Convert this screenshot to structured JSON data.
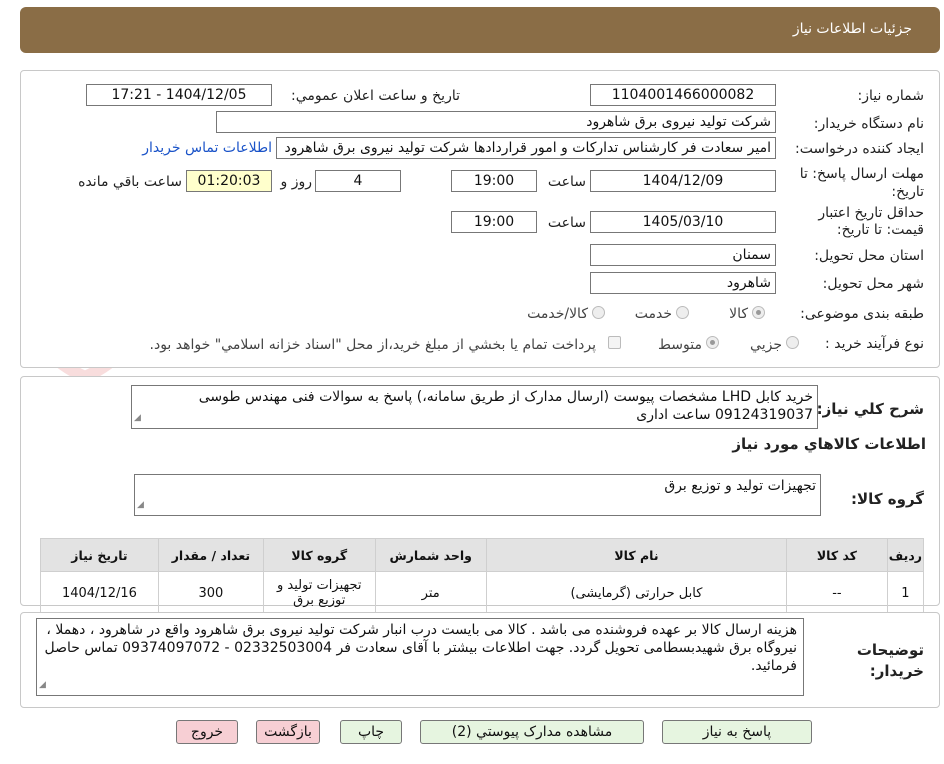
{
  "header": {
    "title": "جزئیات اطلاعات نیاز"
  },
  "need": {
    "number_label": "شماره نیاز:",
    "number": "1104001466000082",
    "announce_label": "تاریخ و ساعت اعلان عمومي:",
    "announce_value": "1404/12/05 - 17:21",
    "buyer_label": "نام دستگاه خريدار:",
    "buyer": "شرکت تولید نیروی برق شاهرود",
    "creator_label": "ايجاد کننده درخواست:",
    "creator": "امیر سعادت فر کارشناس تدارکات و امور قراردادها شرکت تولید نیروی برق شاهرود",
    "contact_link": "اطلاعات تماس خريدار",
    "reply_label_1": "مهلت ارسال پاسخ: تا",
    "reply_label_2": "تاريخ:",
    "reply_date": "1404/12/09",
    "time_label": "ساعت",
    "reply_time": "19:00",
    "days": "4",
    "days_label": "روز و",
    "remaining": "01:20:03",
    "remaining_label": "ساعت باقي مانده",
    "validity_label_1": "حداقل تاريخ اعتبار",
    "validity_label_2": "قيمت: تا تاريخ:",
    "validity_date": "1405/03/10",
    "validity_time": "19:00",
    "province_label": "استان محل تحويل:",
    "province": "سمنان",
    "city_label": "شهر محل تحويل:",
    "city": "شاهرود",
    "category_label": "طبقه بندی موضوعی:",
    "category_options": [
      "کالا",
      "خدمت",
      "کالا/خدمت"
    ],
    "category_selected": "کالا",
    "process_label": "نوع فرآيند خريد :",
    "process_options": [
      "جزيي",
      "متوسط"
    ],
    "process_selected": "متوسط",
    "payment_note": "پرداخت تمام يا بخشي از مبلغ خريد،از محل \"اسناد خزانه اسلامي\" خواهد بود."
  },
  "summary": {
    "label": "شرح کلي نياز:",
    "text": "خرید کابل LHD مشخصات پیوست (ارسال مدارک از طریق سامانه،) پاسخ به سوالات فنی مهندس طوسی 09124319037 ساعت اداری"
  },
  "goods": {
    "section_title": "اطلاعات کالاهاي مورد نياز",
    "group_label": "گروه کالا:",
    "group_value": "تجهيزات توليد و توزيع برق",
    "columns": [
      "رديف",
      "کد کالا",
      "نام کالا",
      "واحد شمارش",
      "گروه کالا",
      "تعداد / مقدار",
      "تاريخ نياز"
    ],
    "rows": [
      {
        "row": "1",
        "code": "--",
        "name": "کابل حرارتی (گرمایشی)",
        "unit": "متر",
        "group": "تجهيزات توليد و توزيع برق",
        "qty": "300",
        "date": "1404/12/16"
      }
    ]
  },
  "buyer_notes": {
    "label": "توضيحات خريدار:",
    "text": "هزینه ارسال کالا بر عهده فروشنده می باشد . کالا می بایست درب انبار شرکت تولید نیروی برق شاهرود واقع در شاهرود ، دهملا ، نیروگاه برق شهیدبسطامی تحویل گردد. جهت اطلاعات بیشتر با آقای سعادت فر  02332503004 - 09374097072 تماس حاصل فرمائید."
  },
  "buttons": {
    "reply": "پاسخ به نياز",
    "attachments": "مشاهده مدارک پيوستي (2)",
    "print": "چاپ",
    "back": "بازگشت",
    "exit": "خروج"
  },
  "colors": {
    "header": "#8a6d46",
    "highlight": "#ffffcc",
    "link": "#1a53c8",
    "green_button": "#e6f5e0",
    "pink_button": "#f7cfd4"
  }
}
